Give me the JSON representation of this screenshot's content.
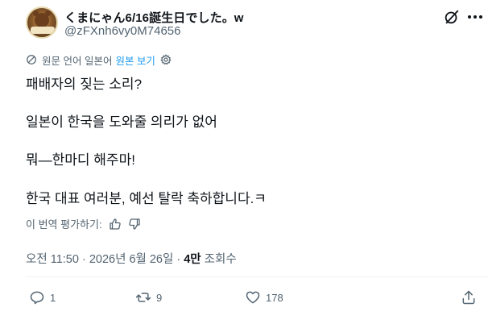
{
  "author": {
    "display_name": "くまにゃん6/16誕生日でした。w",
    "handle": "@zFXnh6vy0M74656"
  },
  "translation": {
    "note": "원문 언어 일본어",
    "show_original": "원본 보기"
  },
  "tweet": {
    "lines": [
      "패배자의 짖는 소리?",
      "일본이 한국을 도와줄 의리가 없어",
      "뭐—한마디 해주마!",
      "한국 대표 여러분, 예선 탈락 축하합니다.ㅋ"
    ]
  },
  "rate_translation": "이 번역 평가하기:",
  "meta": {
    "time": "오전 11:50",
    "separator": " · ",
    "date": "2026년 6월 26일",
    "views_count": "4만",
    "views_label": "조회수"
  },
  "actions": {
    "replies": "1",
    "reposts": "9",
    "likes": "178"
  },
  "icons": {
    "grok": "grok-icon",
    "more": "more-icon",
    "reply": "reply-icon",
    "repost": "repost-icon",
    "like": "like-icon",
    "share": "share-icon"
  },
  "colors": {
    "text": "#0f1419",
    "secondary": "#536471",
    "link": "#1d9bf0"
  }
}
